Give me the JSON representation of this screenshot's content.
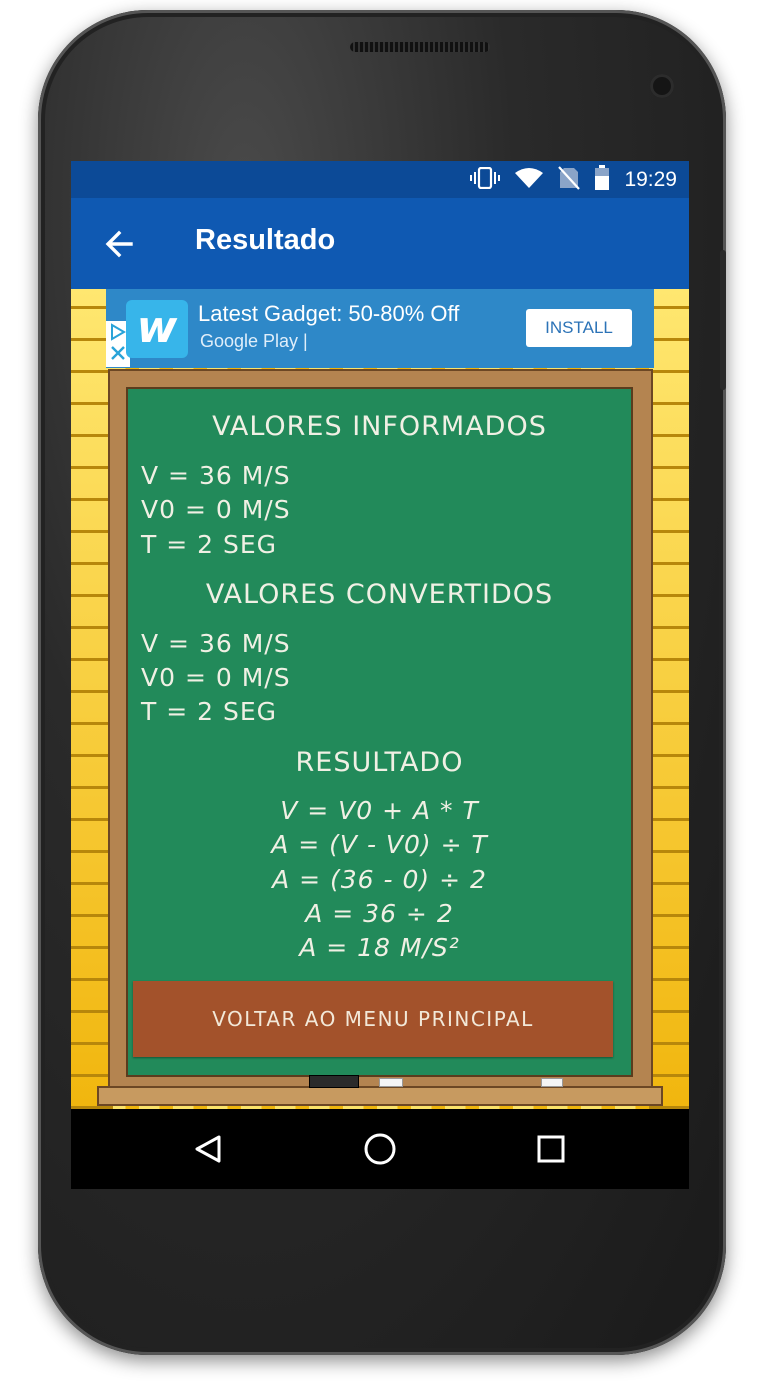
{
  "status_bar": {
    "time": "19:29",
    "icons": [
      "vibrate-icon",
      "wifi-icon",
      "no-sim-icon",
      "battery-icon"
    ]
  },
  "app_bar": {
    "title": "Resultado",
    "back_icon": "arrow-back-icon"
  },
  "ad": {
    "logo_letter": "w",
    "title": "Latest Gadget: 50-80% Off",
    "subtitle": "Google Play  |",
    "install_label": "INSTALL",
    "choices_icon": "ad-choices-icon"
  },
  "board": {
    "informed_heading": "VALORES INFORMADOS",
    "informed": [
      "V = 36 M/S",
      "V0 = 0 M/S",
      "T = 2 SEG"
    ],
    "converted_heading": "VALORES CONVERTIDOS",
    "converted": [
      "V = 36 M/S",
      "V0 = 0 M/S",
      "T = 2 SEG"
    ],
    "result_heading": "RESULTADO",
    "result": [
      "V = V0 + A * T",
      "A = (V - V0) ÷ T",
      "A = (36 - 0) ÷ 2",
      "A = 36 ÷ 2",
      "A = 18 M/S²"
    ],
    "button_label": "VOLTAR AO MENU PRINCIPAL"
  },
  "nav_bar": {
    "icons": [
      "back-triangle-icon",
      "home-circle-icon",
      "recents-square-icon"
    ]
  },
  "colors": {
    "status_bar": "#0c4a97",
    "app_bar": "#0f59b2",
    "chalkboard": "#228a5a",
    "board_button": "#a3522b",
    "brick": "#f3bf15"
  }
}
